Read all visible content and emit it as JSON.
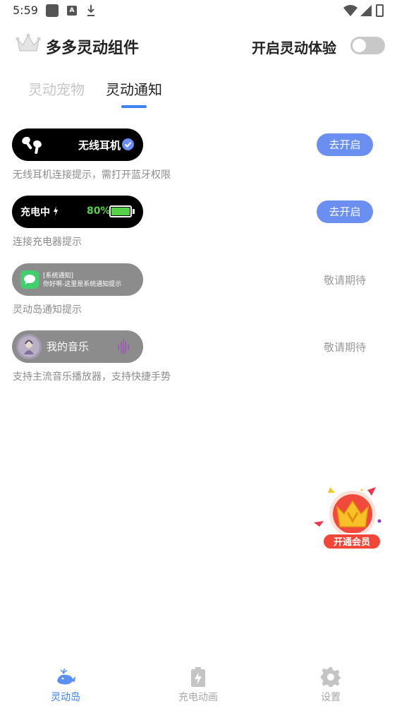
{
  "status_bar": {
    "time": "5:59"
  },
  "header": {
    "app_title": "多多灵动组件",
    "toggle_label": "开启灵动体验",
    "toggle_on": false
  },
  "tabs": [
    {
      "label": "灵动宠物",
      "active": false
    },
    {
      "label": "灵动通知",
      "active": true
    }
  ],
  "features": [
    {
      "pill_text": "无线耳机",
      "icon": "earbuds-icon",
      "description": "无线耳机连接提示，需打开蓝牙权限",
      "action": "去开启",
      "action_enabled": true
    },
    {
      "pill_text": "充电中",
      "battery_percent": "80%",
      "icon": "battery-icon",
      "description": "连接充电器提示",
      "action": "去开启",
      "action_enabled": true
    },
    {
      "msg_title": "[系统通知]",
      "msg_body": "你好啊-这里是系统通知提示",
      "icon": "message-icon",
      "description": "灵动岛通知提示",
      "action": "敬请期待",
      "action_enabled": false
    },
    {
      "pill_text": "我的音乐",
      "icon": "album-icon",
      "description": "支持主流音乐播放器，支持快捷手势",
      "action": "敬请期待",
      "action_enabled": false
    }
  ],
  "vip": {
    "label": "开通会员"
  },
  "bottom_nav": [
    {
      "label": "灵动岛",
      "icon": "whale-icon",
      "active": true
    },
    {
      "label": "充电动画",
      "icon": "charging-icon",
      "active": false
    },
    {
      "label": "设置",
      "icon": "gear-icon",
      "active": false
    }
  ],
  "colors": {
    "accent": "#3d82f0",
    "button": "#6a8ff0",
    "battery_green": "#55d048",
    "vip_red": "#f24638"
  }
}
